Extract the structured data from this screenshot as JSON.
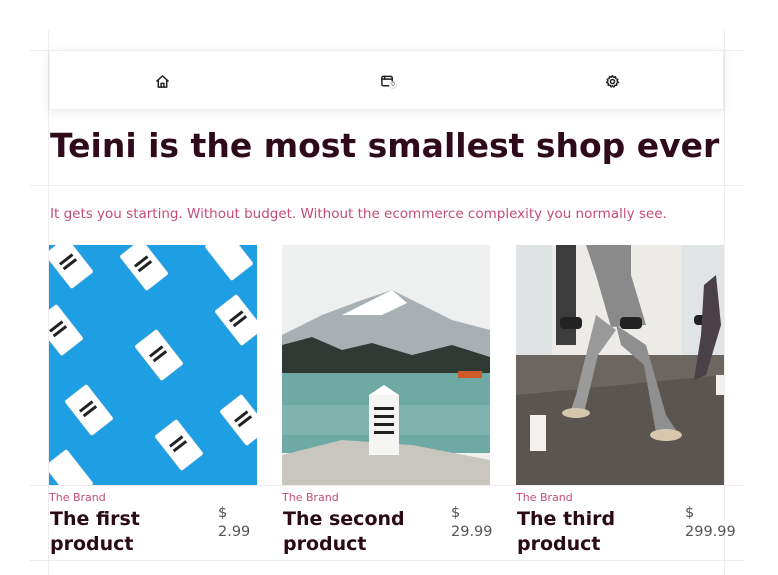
{
  "nav": {
    "items": [
      {
        "name": "home",
        "icon": "home-icon"
      },
      {
        "name": "cart",
        "icon": "cart-icon",
        "badge": "0"
      },
      {
        "name": "settings",
        "icon": "gear-icon"
      }
    ]
  },
  "hero": {
    "title": "Teini is the most smallest shop ever",
    "subtitle": "It gets you starting. Without budget. Without the ecommerce complexity you normally see."
  },
  "products": [
    {
      "brand": "The Brand",
      "name": "The first product",
      "currency": "$",
      "amount": "2.99",
      "image": "boxed water cartons on blue background"
    },
    {
      "brand": "The Brand",
      "name": "The second product",
      "currency": "$",
      "amount": "29.99",
      "image": "boxed water carton at mountain lake"
    },
    {
      "brand": "The Brand",
      "name": "The third product",
      "currency": "$",
      "amount": "299.99",
      "image": "people doing dumbbell lunges in gym"
    }
  ],
  "colors": {
    "accent": "#c64b79",
    "heading": "#2e0a1a"
  }
}
